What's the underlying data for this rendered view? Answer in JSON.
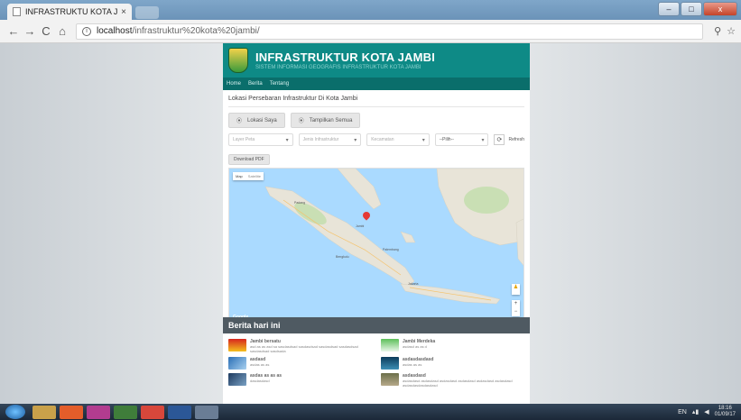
{
  "browser": {
    "tab_title": "INFRASTRUKTU KOTA JA",
    "tab_close": "×",
    "url_host": "localhost",
    "url_path": "/infrastruktur%20kota%20jambi/",
    "back": "←",
    "forward": "→",
    "reload": "C",
    "home": "⌂",
    "zoom_icon": "⚲",
    "star_icon": "☆",
    "win_min": "–",
    "win_max": "□",
    "win_close": "x"
  },
  "site": {
    "title": "INFRASTRUKTUR KOTA JAMBI",
    "subtitle": "SISTEM INFORMASI GEOGRAFIS INFRASTRUKTUR KOTA JAMBI",
    "menu": [
      "Home",
      "Berita",
      "Tentang"
    ]
  },
  "content": {
    "heading": "Lokasi Persebaran Infrastruktur Di Kota Jambi",
    "lokasi_saya": "Lokasi Saya",
    "tampilkan_semua": "Tampilkan Semua",
    "filter_jenis": "Layer Peta",
    "filter_kecamatan": "Jenis Infrastruktur",
    "filter_kelurahan": "Kecamatan",
    "filter_pilih": "--Pilih--",
    "refresh": "Refresh",
    "download_pdf": "Download PDF",
    "select_caret": "▾",
    "refresh_icon": "⟳",
    "bullet": "⦿"
  },
  "map": {
    "map_label": "Map",
    "satellite_label": "Satellite",
    "google": "Google",
    "zoom_in": "+",
    "zoom_out": "−",
    "pegman": "♟",
    "places": {
      "padang": "Padang",
      "palembang": "Palembang",
      "bengkulu": "Bengkulu",
      "jakarta": "Jakarta",
      "jambi": "Jambi"
    }
  },
  "berita": {
    "heading": "Berita hari ini",
    "items": [
      {
        "title": "Jambi bersatu",
        "text": "asd as as asd sa sasdasdsad sasdasdsad sasdasdsad sasdasdsad sasdasdsad sasdsada"
      },
      {
        "title": "Jambi Merdeka",
        "text": "asdasd as as d"
      },
      {
        "title": "asdasd",
        "text": "asdas as as"
      },
      {
        "title": "asdasdasdasd",
        "text": "asdas as as"
      },
      {
        "title": "asdas as as as",
        "text": "dasdasdasd"
      },
      {
        "title": "asdasdasd",
        "text": "asdasdasd asdasdasd asdasdasd asdasdasd asdasdasd asdasdasd asdasdasdasdasdasd"
      }
    ]
  },
  "taskbar": {
    "lang": "EN",
    "time": "18:16",
    "date": "01/09/17"
  }
}
